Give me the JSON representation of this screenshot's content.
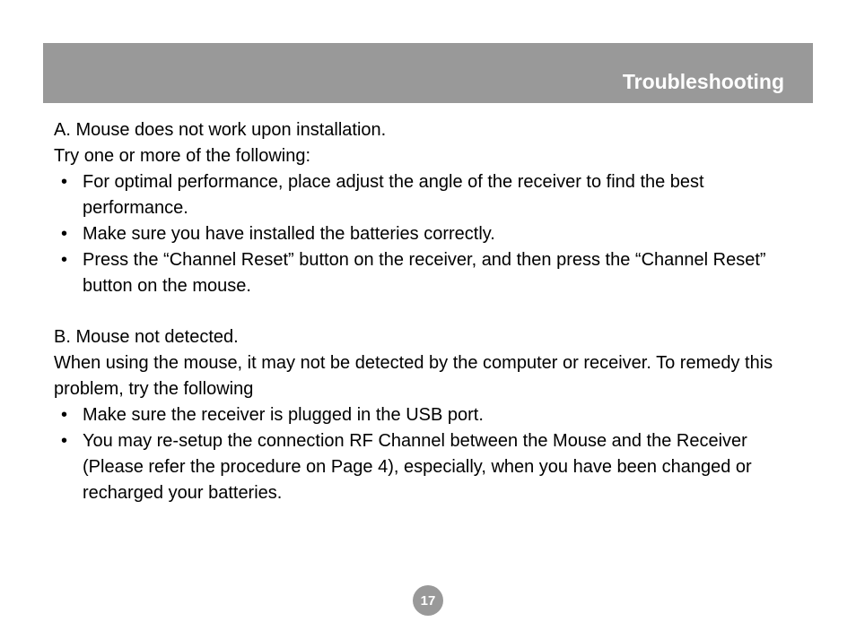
{
  "header": {
    "title": "Troubleshooting"
  },
  "sectionA": {
    "heading": "A. Mouse does not work upon installation.",
    "intro": "Try one or more of the following:",
    "bullets": [
      "For optimal performance, place adjust the angle of the receiver to find the best performance.",
      "Make sure you have installed the batteries correctly.",
      "Press the “Channel Reset” button on the receiver, and then press the “Channel Reset” button on the mouse."
    ]
  },
  "sectionB": {
    "heading": "B. Mouse not detected.",
    "intro": "When using the mouse, it may not be detected by the computer or receiver. To remedy this problem, try the following",
    "bullets": [
      "Make sure the receiver is plugged in the USB port.",
      "You may re-setup the connection RF Channel between the Mouse and the Receiver (Please refer the procedure on Page 4), especially, when you have been changed or recharged your batteries."
    ]
  },
  "pageNumber": "17"
}
